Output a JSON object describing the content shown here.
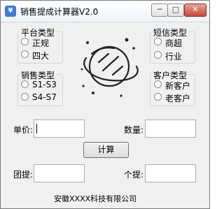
{
  "window": {
    "title": "销售提成计算器V2.0",
    "minimize": "─",
    "maximize": "□",
    "close": "✕"
  },
  "platform_type": {
    "title": "平台类型",
    "options": [
      {
        "label": "正规",
        "selected": false
      },
      {
        "label": "四大",
        "selected": false
      }
    ]
  },
  "sms_type": {
    "title": "短信类型",
    "options": [
      {
        "label": "商超",
        "selected": false
      },
      {
        "label": "行业",
        "selected": false
      }
    ]
  },
  "sales_type": {
    "title": "销售类型",
    "options": [
      {
        "label": "S1-S3",
        "selected": false
      },
      {
        "label": "S4-S7",
        "selected": false
      }
    ]
  },
  "customer_type": {
    "title": "客户类型",
    "options": [
      {
        "label": "新客户",
        "selected": false
      },
      {
        "label": "老客户",
        "selected": false
      }
    ]
  },
  "fields": {
    "unit_price_label": "单价:",
    "unit_price_value": "",
    "quantity_label": "数量:",
    "quantity_value": "",
    "team_commission_label": "团提:",
    "team_commission_value": "",
    "personal_commission_label": "个提:",
    "personal_commission_value": ""
  },
  "calculate_button": "计算",
  "footer_text": "安徽XXXX科技有限公司",
  "icons": {
    "planet": "planet-illustration",
    "app": "app-icon"
  },
  "colors": {
    "window_bg": "#f0f0f0",
    "close_btn": "#c6483a",
    "planet_stroke": "#222222"
  }
}
